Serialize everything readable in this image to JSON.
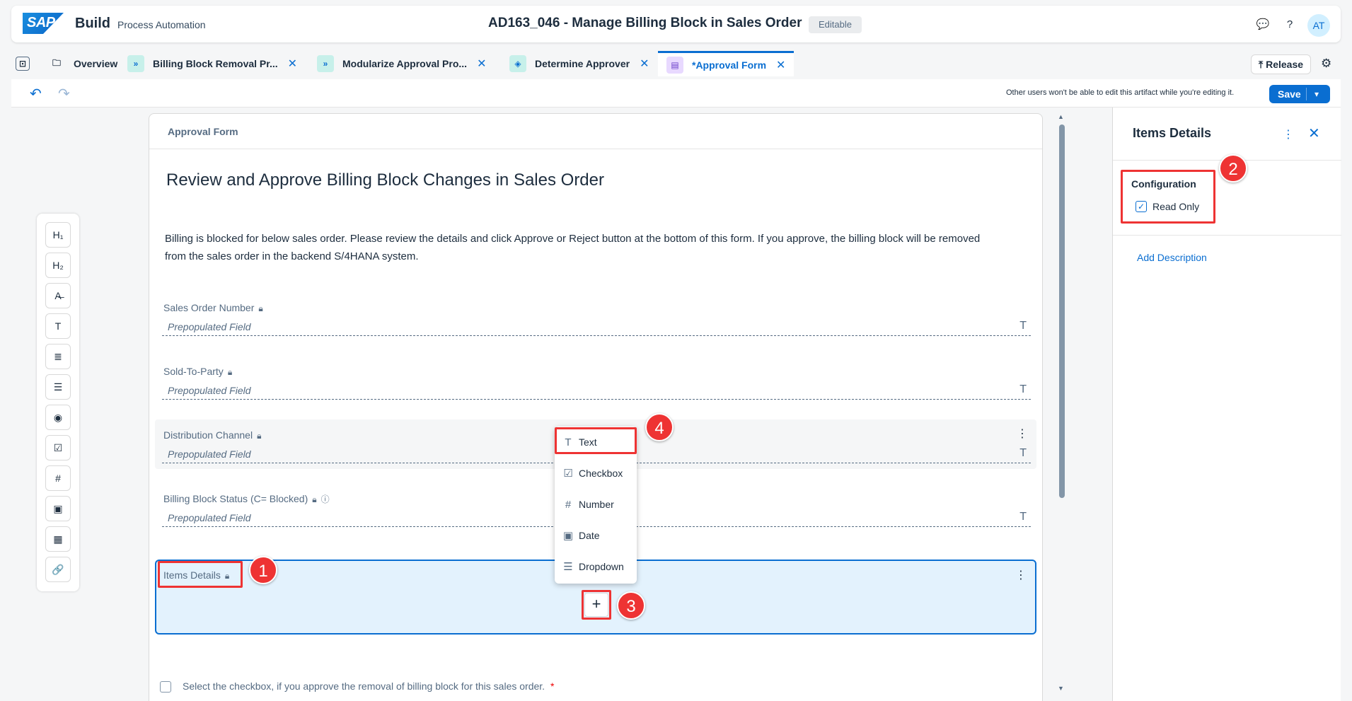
{
  "shell": {
    "logo": "SAP",
    "app_name": "Build",
    "app_sub": "Process Automation",
    "doc_title": "AD163_046 - Manage Billing Block in Sales Order",
    "status": "Editable",
    "avatar": "AT"
  },
  "tabs": [
    {
      "label": "Overview",
      "icon": "folder-icon"
    },
    {
      "label": "Billing Block Removal Pr...",
      "icon": "process-icon"
    },
    {
      "label": "Modularize Approval Pro...",
      "icon": "process-icon"
    },
    {
      "label": "Determine Approver",
      "icon": "decision-icon"
    },
    {
      "label": "*Approval Form",
      "icon": "form-icon",
      "active": true
    }
  ],
  "toolbar": {
    "release_label": "Release",
    "edit_note": "Other users won't be able to edit this artifact while you're editing it.",
    "save_label": "Save"
  },
  "palette": [
    {
      "name": "heading1",
      "glyph": "H₁"
    },
    {
      "name": "heading2",
      "glyph": "H₂"
    },
    {
      "name": "text-style",
      "glyph": "A̶"
    },
    {
      "name": "text-field",
      "glyph": "T"
    },
    {
      "name": "paragraph",
      "glyph": "≣"
    },
    {
      "name": "list",
      "glyph": "☰"
    },
    {
      "name": "radio",
      "glyph": "◉"
    },
    {
      "name": "checkbox",
      "glyph": "☑"
    },
    {
      "name": "number",
      "glyph": "#"
    },
    {
      "name": "date",
      "glyph": "▣"
    },
    {
      "name": "table",
      "glyph": "▦"
    },
    {
      "name": "link",
      "glyph": "🔗"
    }
  ],
  "form": {
    "header": "Approval Form",
    "title": "Review and Approve Billing Block Changes in Sales Order",
    "description": "Billing is blocked for below sales order. Please review the details and click Approve or Reject button at the bottom of this form. If you approve, the billing block will be removed from the sales order in the backend S/4HANA system.",
    "fields": [
      {
        "label": "Sales Order Number",
        "placeholder": "Prepopulated Field"
      },
      {
        "label": "Sold-To-Party",
        "placeholder": "Prepopulated Field"
      },
      {
        "label": "Distribution Channel",
        "placeholder": "Prepopulated Field"
      },
      {
        "label": "Billing Block Status (C= Blocked)",
        "placeholder": "Prepopulated Field"
      }
    ],
    "items_details_label": "Items Details",
    "approve_text": "Select the checkbox, if you approve the removal of billing block for this sales order.",
    "required_mark": "*"
  },
  "menu": {
    "items": [
      {
        "label": "Text",
        "icon": "T"
      },
      {
        "label": "Checkbox",
        "icon": "☑"
      },
      {
        "label": "Number",
        "icon": "#"
      },
      {
        "label": "Date",
        "icon": "▣"
      },
      {
        "label": "Dropdown",
        "icon": "☰"
      }
    ]
  },
  "panel": {
    "title": "Items Details",
    "configuration": "Configuration",
    "read_only": "Read Only",
    "add_description": "Add Description"
  },
  "callouts": [
    "1",
    "2",
    "3",
    "4"
  ]
}
